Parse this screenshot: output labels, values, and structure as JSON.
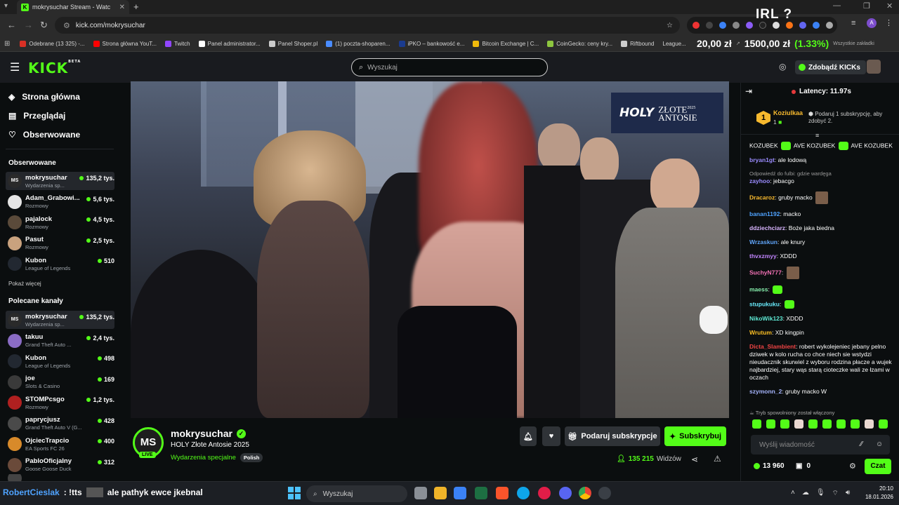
{
  "browser": {
    "tab_title": "mokrysuchar Stream - Watc",
    "url": "kick.com/mokrysuchar",
    "bookmarks": [
      {
        "label": "Odebrane (13 325) -...",
        "color": "#d93025"
      },
      {
        "label": "Strona główna YouT...",
        "color": "#ff0000"
      },
      {
        "label": "Twitch",
        "color": "#9146ff"
      },
      {
        "label": "Panel administrator...",
        "color": "#ffffff"
      },
      {
        "label": "Panel Shoper.pl",
        "color": "#cccccc"
      },
      {
        "label": "(1) poczta-shoparen...",
        "color": "#4a8cff"
      },
      {
        "label": "iPKO – bankowość e...",
        "color": "#1a3b8f"
      },
      {
        "label": "Bitcoin Exchange | C...",
        "color": "#f0b90b"
      },
      {
        "label": "CoinGecko: ceny kry...",
        "color": "#8dc63f"
      },
      {
        "label": "Riftbound",
        "color": "#cccccc"
      }
    ],
    "overlay_irl": "IRL ?",
    "ticker_amount": "20,00 zł",
    "ticker_arrow": "↗",
    "ticker_total": "1500,00 zł",
    "ticker_pct": "(1.33%)",
    "ticker_tail_left": "League...",
    "ticker_tail_right": "Wszystkie zakładki"
  },
  "header": {
    "logo": "KICK",
    "logo_beta": "BETA",
    "search_placeholder": "Wyszukaj",
    "get_kicks": "Zdobądź KICKs"
  },
  "sidebar": {
    "nav": [
      {
        "label": "Strona główna",
        "icon": "compass-icon"
      },
      {
        "label": "Przeglądaj",
        "icon": "browse-icon"
      },
      {
        "label": "Obserwowane",
        "icon": "heart-icon"
      }
    ],
    "followed_title": "Obserwowane",
    "followed": [
      {
        "name": "mokrysuchar",
        "category": "Wydarzenia sp...",
        "viewers": "135,2 tys.",
        "color": "#2a2a2a",
        "initials": "MS"
      },
      {
        "name": "Adam_Grabowi...",
        "category": "Rozmowy",
        "viewers": "5,6 tys.",
        "color": "#e5e5e5",
        "initials": ""
      },
      {
        "name": "pajalock",
        "category": "Rozmowy",
        "viewers": "4,5 tys.",
        "color": "#5a4a3a",
        "initials": ""
      },
      {
        "name": "Pasut",
        "category": "Rozmowy",
        "viewers": "2,5 tys.",
        "color": "#c9a27e",
        "initials": ""
      },
      {
        "name": "Kubon",
        "category": "League of Legends",
        "viewers": "510",
        "color": "#222831",
        "initials": ""
      }
    ],
    "show_more": "Pokaż więcej",
    "recommended_title": "Polecane kanały",
    "recommended": [
      {
        "name": "mokrysuchar",
        "category": "Wydarzenia sp...",
        "viewers": "135,2 tys.",
        "color": "#2a2a2a",
        "initials": "MS"
      },
      {
        "name": "takuu",
        "category": "Grand Theft Auto ...",
        "viewers": "2,4 tys.",
        "color": "#8a6cc4",
        "initials": ""
      },
      {
        "name": "Kubon",
        "category": "League of Legends",
        "viewers": "498",
        "color": "#222831",
        "initials": ""
      },
      {
        "name": "joe",
        "category": "Slots & Casino",
        "viewers": "169",
        "color": "#3a3a3a",
        "initials": ""
      },
      {
        "name": "STOMPcsgo",
        "category": "Rozmowy",
        "viewers": "1,2 tys.",
        "color": "#b02020",
        "initials": ""
      },
      {
        "name": "paprycjusz",
        "category": "Grand Theft Auto V (G...",
        "viewers": "428",
        "color": "#4a4a4a",
        "initials": ""
      },
      {
        "name": "OjciecTrapcio",
        "category": "EA Sports FC 26",
        "viewers": "400",
        "color": "#d88a2a",
        "initials": ""
      },
      {
        "name": "PabloOficjalny",
        "category": "Goose Goose Duck",
        "viewers": "312",
        "color": "#6a4a3a",
        "initials": ""
      }
    ]
  },
  "video": {
    "overlay_holy": "HOLY",
    "overlay_line1": "ZŁOTE",
    "overlay_line2": "ANTOSIE",
    "overlay_year": "2025"
  },
  "stream": {
    "initials": "MS",
    "live": "LIVE",
    "name": "mokrysuchar",
    "title": "HOLY Złote Antosie 2025",
    "category": "Wydarzenia specjalne",
    "language": "Polish",
    "gift_sub_label": "Podaruj subskrypcje",
    "subscribe_label": "Subskrybuj",
    "viewers": "135 215",
    "viewers_label": "Widzów"
  },
  "chat": {
    "latency": "Latency: 11.97s",
    "gift_rank": "1",
    "gift_user": "Koziulkaa",
    "gift_count": "1",
    "gift_message": "Podaruj 1 subskrypcję, aby zdobyć 2.",
    "messages": [
      {
        "user": "",
        "color": "#ffffff",
        "text": "KOZUBEK [e] AVE KOZUBEK [e] AVE KOZUBEK",
        "reply": ""
      },
      {
        "user": "bryan1gt",
        "color": "#9b8cff",
        "text": "ale lodową",
        "reply": ""
      },
      {
        "user": "zayhoo",
        "color": "#9b8cff",
        "text": "jebacgo",
        "reply": "Odpowiedź do fulbi: gdzie wardęga"
      },
      {
        "user": "Dracaroz",
        "color": "#f7b92e",
        "text": "gruby macko [p]",
        "reply": ""
      },
      {
        "user": "banan1192",
        "color": "#4fa3ff",
        "text": "macko",
        "reply": ""
      },
      {
        "user": "ddziechciarz",
        "color": "#d8b4fe",
        "text": "Boże jaka biedna",
        "reply": ""
      },
      {
        "user": "Wrzaskun",
        "color": "#60a5fa",
        "text": "ale knury",
        "reply": ""
      },
      {
        "user": "thvxzmyy",
        "color": "#c084fc",
        "text": "XDDD",
        "reply": ""
      },
      {
        "user": "SuchyN777",
        "color": "#f472b6",
        "text": "[p]",
        "reply": ""
      },
      {
        "user": "maess",
        "color": "#86efac",
        "text": "[e]",
        "reply": ""
      },
      {
        "user": "stupukuku",
        "color": "#67e8f9",
        "text": "[e]",
        "reply": ""
      },
      {
        "user": "NikoWik123",
        "color": "#5eead4",
        "text": "XDDD",
        "reply": ""
      },
      {
        "user": "Wrutum",
        "color": "#fbbf24",
        "text": "XD kingpin",
        "reply": ""
      },
      {
        "user": "Dicta_Slambient",
        "color": "#ef4444",
        "text": "robert wykolejeniec jebany pelno dziwek w kolo rucha co chce niech sie wstydzi nieudacznik skurwiel z wyboru rodzina płacze a wujek najbardziej, stary wąs starą cioteczke wali ze łzami w oczach",
        "reply": ""
      },
      {
        "user": "szymonn_2",
        "color": "#a5b4fc",
        "text": "gruby macko W",
        "reply": ""
      }
    ],
    "slow_mode": "Tryb spowolniony został włączony",
    "input_placeholder": "Wyślij wiadomość",
    "kicks_balance": "13 960",
    "gifts_count": "0",
    "send_label": "Czat"
  },
  "taskbar": {
    "tts_user": "RobertCieslak",
    "tts_prefix": ": !tts",
    "tts_text": "ale pathyk ewce jkebnal",
    "search_placeholder": "Wyszukaj",
    "time": "20:10",
    "date": "18.01.2026"
  }
}
